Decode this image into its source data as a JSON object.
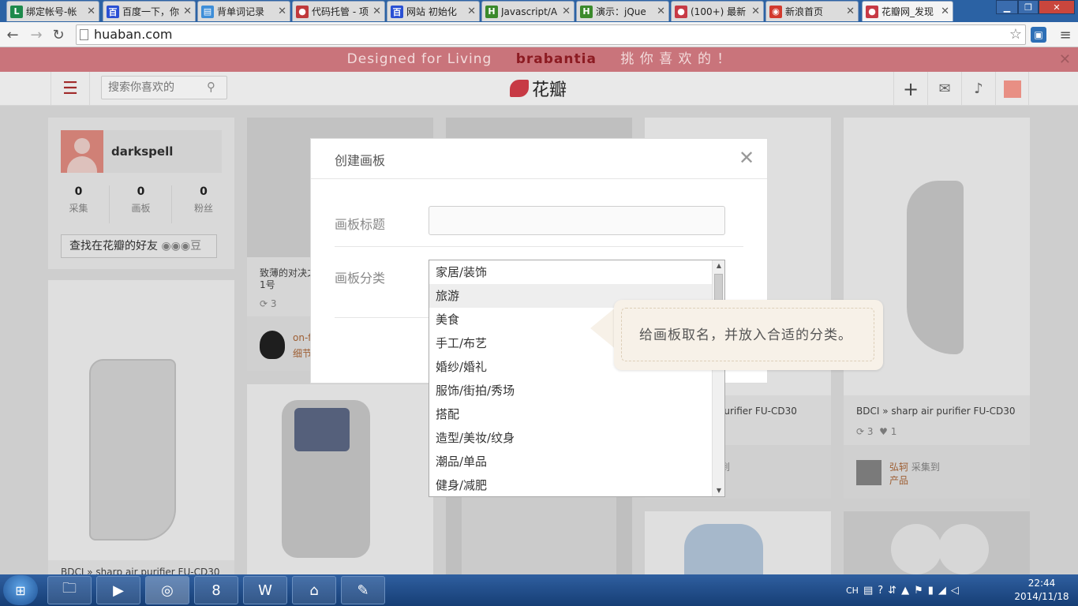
{
  "browser": {
    "tabs": [
      {
        "title": "绑定帐号-帐",
        "favicon": "L",
        "color": "#1e8a4c"
      },
      {
        "title": "百度一下，你",
        "favicon": "百",
        "color": "#2a50d4"
      },
      {
        "title": "背单词记录",
        "favicon": "▤",
        "color": "#3e8ed8"
      },
      {
        "title": "代码托管 - 项",
        "favicon": "●",
        "color": "#c0393b"
      },
      {
        "title": "网站 初始化",
        "favicon": "百",
        "color": "#2a50d4"
      },
      {
        "title": "Javascript/A",
        "favicon": "H",
        "color": "#3b8a2c"
      },
      {
        "title": "演示：jQue",
        "favicon": "H",
        "color": "#3b8a2c"
      },
      {
        "title": "(100+) 最新",
        "favicon": "●",
        "color": "#c73a45"
      },
      {
        "title": "新浪首页",
        "favicon": "◉",
        "color": "#d23a2e"
      },
      {
        "title": "花瓣网_发现",
        "favicon": "●",
        "color": "#c73a45"
      }
    ],
    "url": "huaban.com"
  },
  "banner": {
    "left": "Designed for Living",
    "brand": "brabantia",
    "right": "挑 你 喜 欢 的 ！"
  },
  "header": {
    "search_placeholder": "搜索你喜欢的",
    "logo_text": "花瓣"
  },
  "profile": {
    "username": "darkspell",
    "stats": [
      {
        "num": "0",
        "label": "采集"
      },
      {
        "num": "0",
        "label": "画板"
      },
      {
        "num": "0",
        "label": "粉丝"
      }
    ],
    "find_friends": "查找在花瓣的好友"
  },
  "pins": {
    "p1_caption_a": "致薄的对决之",
    "p1_caption_b": "1号",
    "p1_repins": "3",
    "p1_user": "on-f",
    "p1_sub": "细节",
    "p4_caption": "r purifier FU-CD30",
    "p4_meta": "集到",
    "p5_caption": "BDCI » sharp air purifier FU-CD30",
    "p5_repins": "3",
    "p5_likes": "1",
    "p5_user": "弘轲",
    "p5_action": "采集到",
    "p5_board": "产品",
    "left_caption": "BDCI » sharp air purifier FU-CD30"
  },
  "modal": {
    "title": "创建画板",
    "label_title": "画板标题",
    "label_category": "画板分类",
    "categories": [
      "家居/装饰",
      "旅游",
      "美食",
      "手工/布艺",
      "婚纱/婚礼",
      "服饰/街拍/秀场",
      "搭配",
      "造型/美妆/纹身",
      "潮品/单品",
      "健身/减肥"
    ],
    "highlighted_category": "旅游",
    "tooltip": "给画板取名，并放入合适的分类。"
  },
  "taskbar": {
    "lang": "CH",
    "time": "22:44",
    "date": "2014/11/18"
  }
}
